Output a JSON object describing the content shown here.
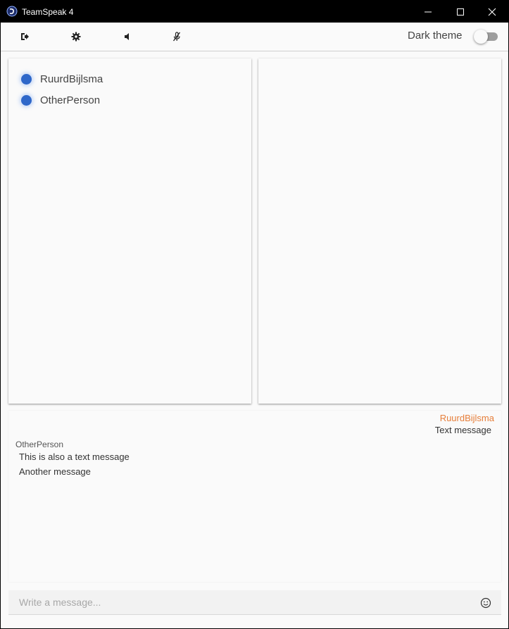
{
  "window": {
    "title": "TeamSpeak 4"
  },
  "toolbar": {
    "buttons": [
      {
        "icon": "logout-icon"
      },
      {
        "icon": "gear-icon"
      },
      {
        "icon": "speaker-icon"
      },
      {
        "icon": "microphone-muted-icon"
      }
    ],
    "theme_label": "Dark theme",
    "dark_theme_enabled": false
  },
  "users": [
    {
      "name": "RuurdBijlsma",
      "status_color": "#2e67c9"
    },
    {
      "name": "OtherPerson",
      "status_color": "#2e67c9"
    }
  ],
  "chat": {
    "groups": [
      {
        "sender": "RuurdBijlsma",
        "align": "right",
        "sender_color": "#e67e3a",
        "messages": [
          "Text message"
        ]
      },
      {
        "sender": "OtherPerson",
        "align": "left",
        "sender_color": "#555555",
        "messages": [
          "This is also a text message",
          "Another message"
        ]
      }
    ]
  },
  "input": {
    "placeholder": "Write a message...",
    "value": ""
  },
  "colors": {
    "accent": "#2e67c9",
    "titlebar": "#000000",
    "background": "#fafafa"
  }
}
